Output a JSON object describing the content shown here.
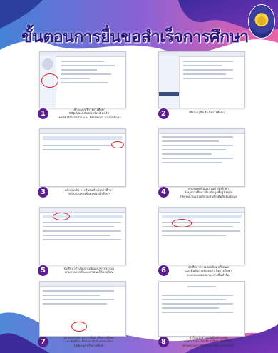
{
  "title": "ขั้นตอนการยื่นขอสำเร็จการศึกษา",
  "colors": {
    "purple": "#5b1d8f",
    "blue": "#2f74d0",
    "pink": "#e8509d",
    "highlight": "#d92525"
  },
  "steps": [
    {
      "number": "1",
      "caption": [
        "เข้าระบบบริการการศึกษา",
        "http://academic.dusit.ac.th",
        "โดยใช้ Username และ Password ของนักศึกษา"
      ]
    },
    {
      "number": "2",
      "caption": [
        "เลือกเมนูยื่นสำเร็จการศึกษา"
      ]
    },
    {
      "number": "3",
      "caption": [
        "คลิกปุ่มเพิ่ม การยื่นขอสำเร็จการศึกษา",
        "ระบบจะแสดงข้อมูลของนักศึกษา"
      ]
    },
    {
      "number": "4",
      "caption": [
        "ตรวจสอบข้อมูลส่วนตัวนักศึกษา",
        "ข้อมูลการศึกษาเดิม ข้อมูลที่อยู่ปัจจุบัน",
        "ให้ครบถ้วนแล้วคลิกปุ่มบันทึกเพื่อยืนยันข้อมูล"
      ]
    },
    {
      "number": "5",
      "caption": [
        "นักศึกษาดำเนินการเพิ่มเอกสารประกอบ",
        "ตามรายการที่ระบบกำหนดให้ครบถ้วน"
      ]
    },
    {
      "number": "6",
      "caption": [
        "นักศึกษาตรวจสอบข้อมูลทั้งหมด",
        "และยืนยันการยื่นขอสำเร็จการศึกษา",
        "ระบบจะแสดงสถานะการยื่นคำร้อง"
      ]
    },
    {
      "number": "7",
      "caption": [
        "ตรวจสอบสถานะการยื่นสำเร็จการศึกษา",
        "และพิมพ์ใบแจ้งชำระเงินค่าธรรมเนียม",
        "ได้ที่เมนูสำเร็จการศึกษา"
      ]
    },
    {
      "number": "8",
      "caption": [
        "นำใบแจ้งชำระเงินไปชำระเงิน",
        "ภายในระยะเวลาที่มหาวิทยาลัยกำหนด",
        "ผ่านธนาคารหรือช่องทางที่ระบุในใบแจ้ง"
      ]
    }
  ]
}
